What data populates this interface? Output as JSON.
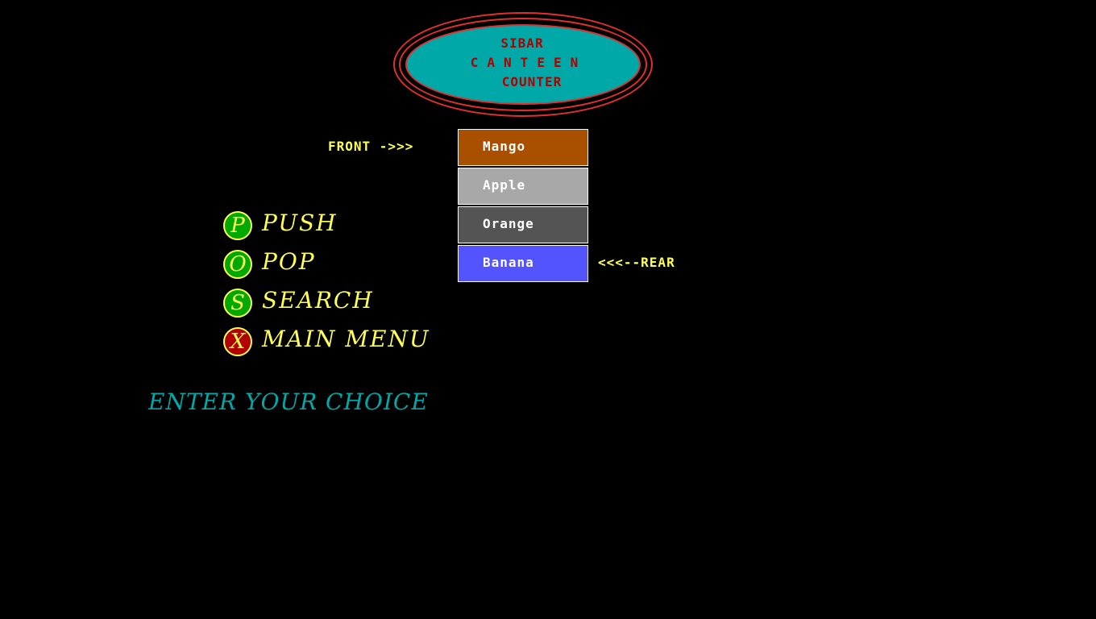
{
  "header": {
    "line1": "SIBAR",
    "line2": "CANTEEN",
    "line3": "COUNTER"
  },
  "queue": {
    "front_label": "FRONT ->>>",
    "rear_label": "<<<--REAR",
    "items": [
      {
        "label": "Mango",
        "color": "#a85000"
      },
      {
        "label": "Apple",
        "color": "#a8a8a8"
      },
      {
        "label": "Orange",
        "color": "#545454"
      },
      {
        "label": "Banana",
        "color": "#5454ff"
      }
    ]
  },
  "menu": {
    "items": [
      {
        "key": "P",
        "label": "PUSH",
        "key_color": "green"
      },
      {
        "key": "O",
        "label": "POP",
        "key_color": "green"
      },
      {
        "key": "S",
        "label": "SEARCH",
        "key_color": "green"
      },
      {
        "key": "X",
        "label": "MAIN MENU",
        "key_color": "red"
      }
    ]
  },
  "prompt": "ENTER YOUR CHOICE",
  "colors": {
    "background": "#000000",
    "accent_yellow": "#ffff55",
    "cyan": "#00a8a8",
    "red": "#e03030"
  }
}
